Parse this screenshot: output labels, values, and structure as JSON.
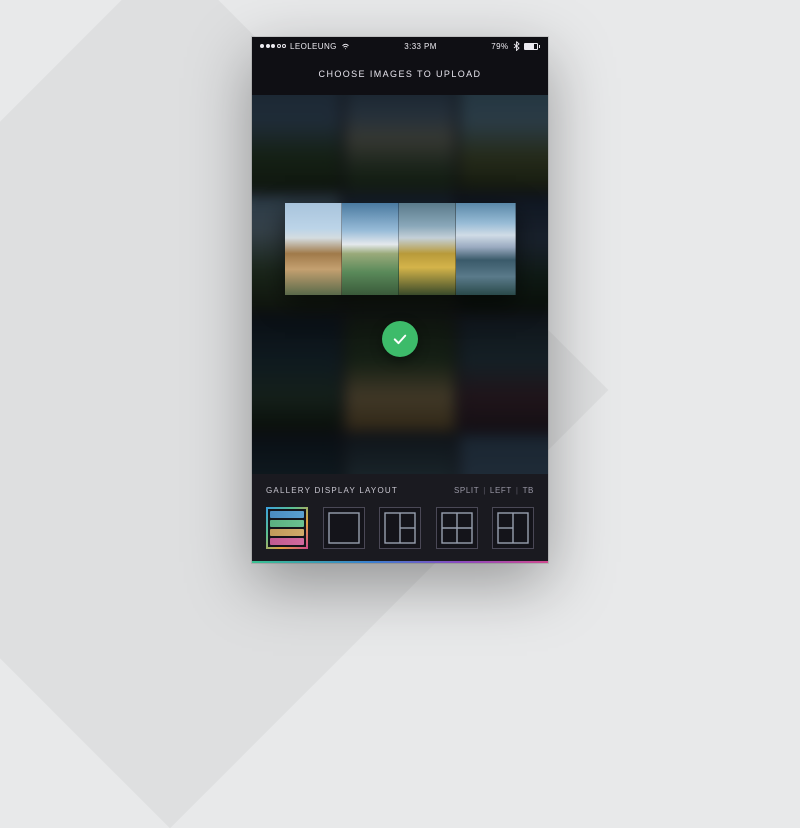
{
  "statusbar": {
    "carrier": "LEOLEUNG",
    "time": "3:33 PM",
    "battery": "79%"
  },
  "header": {
    "title": "CHOOSE IMAGES TO UPLOAD"
  },
  "confirm": {
    "icon": "check-icon"
  },
  "footer": {
    "label": "GALLERY DISPLAY LAYOUT",
    "modes": [
      "SPLIT",
      "LEFT",
      "TB"
    ],
    "layouts": [
      {
        "id": "rows",
        "selected": true
      },
      {
        "id": "single",
        "selected": false
      },
      {
        "id": "left-split",
        "selected": false
      },
      {
        "id": "quad",
        "selected": false
      },
      {
        "id": "right-split",
        "selected": false
      }
    ]
  },
  "colors": {
    "confirm": "#3dbb6a"
  }
}
